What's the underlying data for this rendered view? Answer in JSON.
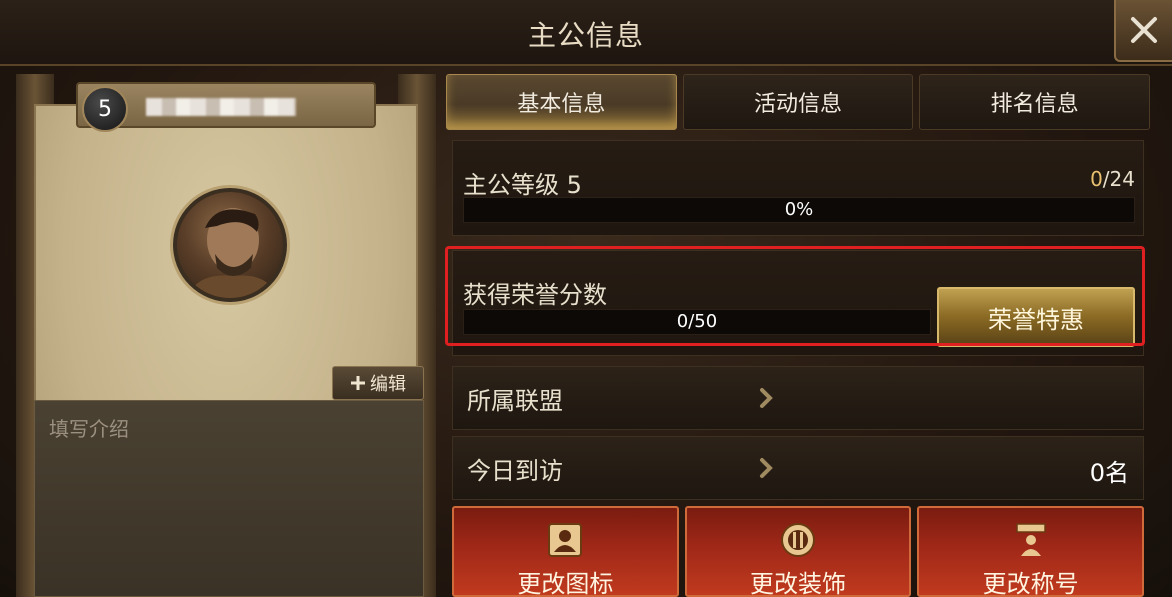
{
  "window": {
    "title": "主公信息"
  },
  "profile": {
    "level": "5",
    "edit_label": "编辑",
    "intro_placeholder": "填写介绍"
  },
  "tabs": [
    {
      "label": "基本信息",
      "active": true
    },
    {
      "label": "活动信息",
      "active": false
    },
    {
      "label": "排名信息",
      "active": false
    }
  ],
  "lord_level": {
    "label": "主公等级 5",
    "current": "0",
    "slash": "/",
    "max": "24",
    "progress_text": "0%",
    "progress": 0
  },
  "honor": {
    "label": "获得荣誉分数",
    "progress_text": "0/50",
    "progress": 0,
    "button_label": "荣誉特惠"
  },
  "rows": [
    {
      "label": "所属联盟",
      "value": ""
    },
    {
      "label": "今日到访",
      "value": "0名"
    }
  ],
  "actions": [
    {
      "label": "更改图标",
      "icon": "portrait-icon"
    },
    {
      "label": "更改装饰",
      "icon": "frame-icon"
    },
    {
      "label": "更改称号",
      "icon": "title-icon"
    }
  ],
  "colors": {
    "accent": "#e8c070",
    "highlight": "#e02020",
    "action_red": "#a02818"
  }
}
